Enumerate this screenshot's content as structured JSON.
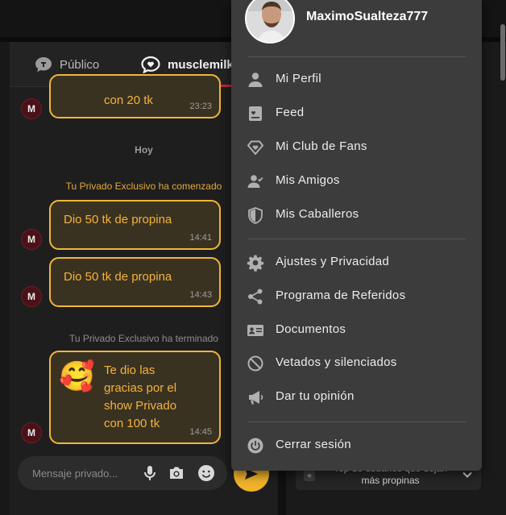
{
  "tabs": {
    "public_label": "Público",
    "private_label": "musclemilk"
  },
  "chat": {
    "m_initial": "M",
    "day_label": "Hoy",
    "messages": [
      {
        "text": "con 20 tk",
        "time": "23:23"
      },
      {
        "text": "Dio 50 tk de propina",
        "time": "14:41"
      },
      {
        "text": "Dio 50 tk de propina",
        "time": "14:43"
      },
      {
        "lines": [
          "Te dio las",
          "gracias por el",
          "show Privado",
          "con 100 tk"
        ],
        "time": "14:45",
        "emoji": "🥰"
      }
    ],
    "private_started": "Tu Privado Exclusivo ha comenzado",
    "private_ended": "Tu Privado Exclusivo ha terminado"
  },
  "composer": {
    "placeholder": "Mensaje privado..."
  },
  "right_panel": {
    "top_users_line1": "Top de usuarios que dejan",
    "top_users_line2": "más propinas"
  },
  "menu": {
    "username": "MaximoSualteza777",
    "items": [
      {
        "label": "Mi Perfil",
        "icon": "person-icon"
      },
      {
        "label": "Feed",
        "icon": "feed-icon"
      },
      {
        "label": "Mi Club de Fans",
        "icon": "diamond-icon"
      },
      {
        "label": "Mis Amigos",
        "icon": "friends-icon"
      },
      {
        "label": "Mis Caballeros",
        "icon": "shield-icon"
      },
      {
        "label": "Ajustes y Privacidad",
        "icon": "gear-icon"
      },
      {
        "label": "Programa de Referidos",
        "icon": "share-icon"
      },
      {
        "label": "Documentos",
        "icon": "id-card-icon"
      },
      {
        "label": "Vetados y silenciados",
        "icon": "ban-icon"
      },
      {
        "label": "Dar tu opinión",
        "icon": "megaphone-icon"
      },
      {
        "label": "Cerrar sesión",
        "icon": "power-icon"
      }
    ]
  },
  "colors": {
    "accent_gold": "#f0b73a",
    "tab_underline": "#c0283c",
    "menu_bg": "#3c3c3c"
  }
}
